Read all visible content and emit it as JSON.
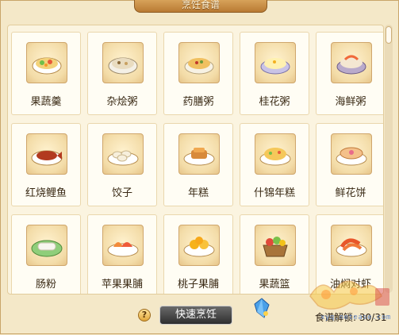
{
  "window": {
    "title": "烹饪食谱"
  },
  "recipes": [
    {
      "name": "果蔬羹",
      "icon": "fruit-veg-soup-icon"
    },
    {
      "name": "杂烩粥",
      "icon": "mixed-porridge-icon"
    },
    {
      "name": "药膳粥",
      "icon": "herbal-porridge-icon"
    },
    {
      "name": "桂花粥",
      "icon": "osmanthus-porridge-icon"
    },
    {
      "name": "海鲜粥",
      "icon": "seafood-porridge-icon"
    },
    {
      "name": "红烧鲤鱼",
      "icon": "braised-carp-icon"
    },
    {
      "name": "饺子",
      "icon": "dumplings-icon"
    },
    {
      "name": "年糕",
      "icon": "rice-cake-icon"
    },
    {
      "name": "什锦年糕",
      "icon": "assorted-rice-cake-icon"
    },
    {
      "name": "鲜花饼",
      "icon": "flower-cake-icon"
    },
    {
      "name": "肠粉",
      "icon": "rice-noodle-roll-icon"
    },
    {
      "name": "苹果果脯",
      "icon": "apple-preserve-icon"
    },
    {
      "name": "桃子果脯",
      "icon": "peach-preserve-icon"
    },
    {
      "name": "果蔬篮",
      "icon": "fruit-basket-icon"
    },
    {
      "name": "油焖对虾",
      "icon": "braised-prawns-icon"
    }
  ],
  "footer": {
    "help_label": "?",
    "quick_cook_label": "快速烹饪",
    "unlock_label": "食谱解锁:",
    "unlock_count": "30/31"
  },
  "watermark": {
    "text": "xyq.netease.com"
  },
  "colors": {
    "background": "#f3e6c6",
    "panel": "#fbf4e0",
    "title_tab": "#c98f45",
    "button": "#3c3c3c",
    "unlock_count": "#2a1e10"
  }
}
